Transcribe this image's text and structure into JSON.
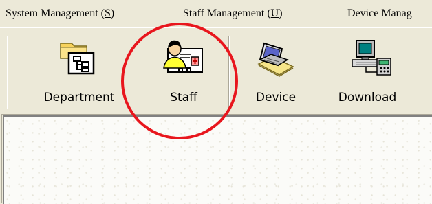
{
  "menu": {
    "items": [
      {
        "label": "System Management (S)",
        "underline": "S"
      },
      {
        "label": "Staff Management (U)",
        "underline": "U"
      },
      {
        "label": "Device Manag",
        "underline": ""
      }
    ]
  },
  "toolbar": {
    "buttons": [
      {
        "label": "Department",
        "icon": "department-icon"
      },
      {
        "label": "Staff",
        "icon": "staff-icon"
      },
      {
        "label": "Device",
        "icon": "device-icon"
      },
      {
        "label": "Download",
        "icon": "download-icon"
      }
    ]
  },
  "annotation": {
    "color": "#e8161d",
    "target": "Staff"
  },
  "colors": {
    "chrome": "#ece9d8",
    "workspace": "#fbfbf8"
  }
}
